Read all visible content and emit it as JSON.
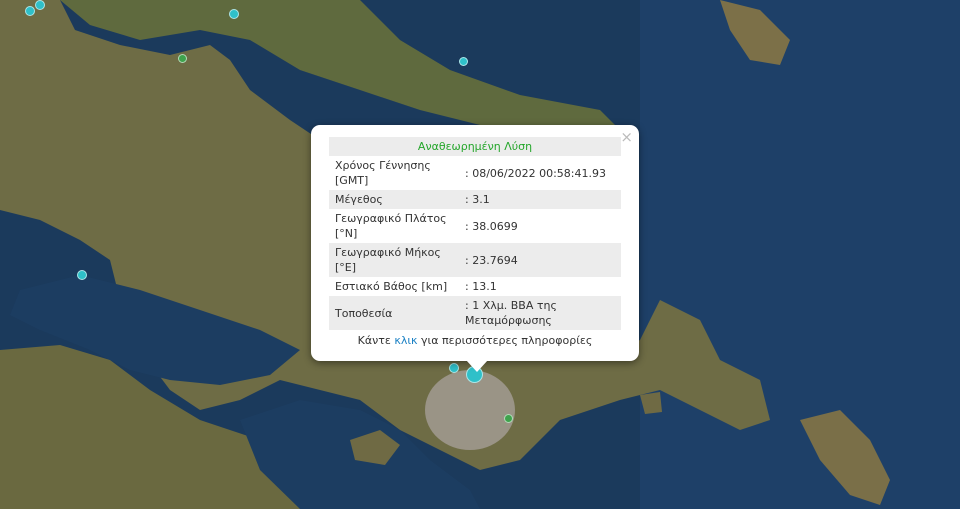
{
  "popup": {
    "title": "Αναθεωρημένη Λύση",
    "close_symbol": "×",
    "rows": [
      {
        "label": "Χρόνος Γέννησης [GMT]",
        "value": ": 08/06/2022 00:58:41.93"
      },
      {
        "label": "Μέγεθος",
        "value": ": 3.1"
      },
      {
        "label": "Γεωγραφικό Πλάτος [°N]",
        "value": ": 38.0699"
      },
      {
        "label": "Γεωγραφικό Μήκος [°E]",
        "value": ": 23.7694"
      },
      {
        "label": "Εστιακό Βάθος [km]",
        "value": ": 13.1"
      },
      {
        "label": "Τοποθεσία",
        "value": ": 1 Χλμ. ΒΒΑ της Μεταμόρφωσης"
      }
    ],
    "more_prefix": "Κάντε ",
    "more_link": "κλικ",
    "more_suffix": " για περισσότερες πληροφορίες"
  },
  "colors": {
    "sea": "#1b3a5c",
    "land": "#6b6a44",
    "marker_cyan": "#2fc0c9",
    "marker_green": "#3fa34d",
    "title_green": "#24a62a",
    "link": "#1a80c4"
  },
  "markers": [
    {
      "name": "quake-marker-cyan",
      "color": "cyan"
    },
    {
      "name": "quake-marker-cyan",
      "color": "cyan"
    },
    {
      "name": "quake-marker-cyan",
      "color": "cyan"
    },
    {
      "name": "quake-marker-green",
      "color": "green"
    },
    {
      "name": "quake-marker-cyan",
      "color": "cyan"
    },
    {
      "name": "quake-marker-cyan",
      "color": "cyan"
    },
    {
      "name": "quake-marker-cyan",
      "color": "cyan"
    },
    {
      "name": "quake-marker-selected",
      "color": "cyan"
    },
    {
      "name": "quake-marker-green",
      "color": "green"
    }
  ]
}
